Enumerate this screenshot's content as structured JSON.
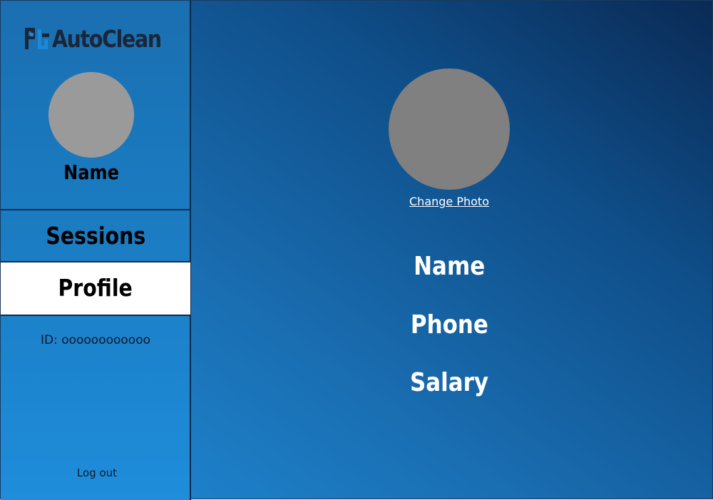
{
  "brand": {
    "name": "AutoClean",
    "icon": "autoclean-logo-icon",
    "colors": {
      "icon_blue": "#1e88d8",
      "text_dark": "#1b2638"
    }
  },
  "sidebar": {
    "user_name": "Name",
    "nav": {
      "sessions": "Sessions",
      "profile": "Profile"
    },
    "active_item": "Profile",
    "employee_id": "ID: oooooooooooo",
    "logout": "Log out"
  },
  "profile": {
    "change_photo": "Change Photo",
    "fields": {
      "name": "Name",
      "phone": "Phone",
      "salary": "Salary"
    }
  }
}
